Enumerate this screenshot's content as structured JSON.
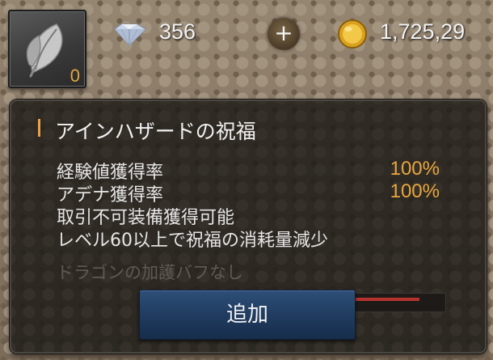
{
  "hud": {
    "item_icon": "leaf-icon",
    "item_count": "0",
    "diamond_icon": "diamond-icon",
    "diamond_count": "356",
    "add_icon": "plus-icon",
    "add_label": "+",
    "gold_icon": "gold-coin-icon",
    "gold_count": "1,725,29"
  },
  "tooltip": {
    "title": "アインハザードの祝福",
    "effects": [
      {
        "label": "経験値獲得率",
        "value": "100%"
      },
      {
        "label": "アデナ獲得率",
        "value": "100%"
      },
      {
        "label": "取引不可装備獲得可能",
        "value": ""
      },
      {
        "label": "レベル60以上で祝福の消耗量減少",
        "value": ""
      }
    ],
    "disabled_note": "ドラゴンの加護バフなし",
    "button_label": "追加"
  },
  "colors": {
    "accent": "#e9a63e",
    "button": "#203c60",
    "text": "#e6e6e6",
    "disabled_text": "#5f5a54"
  }
}
